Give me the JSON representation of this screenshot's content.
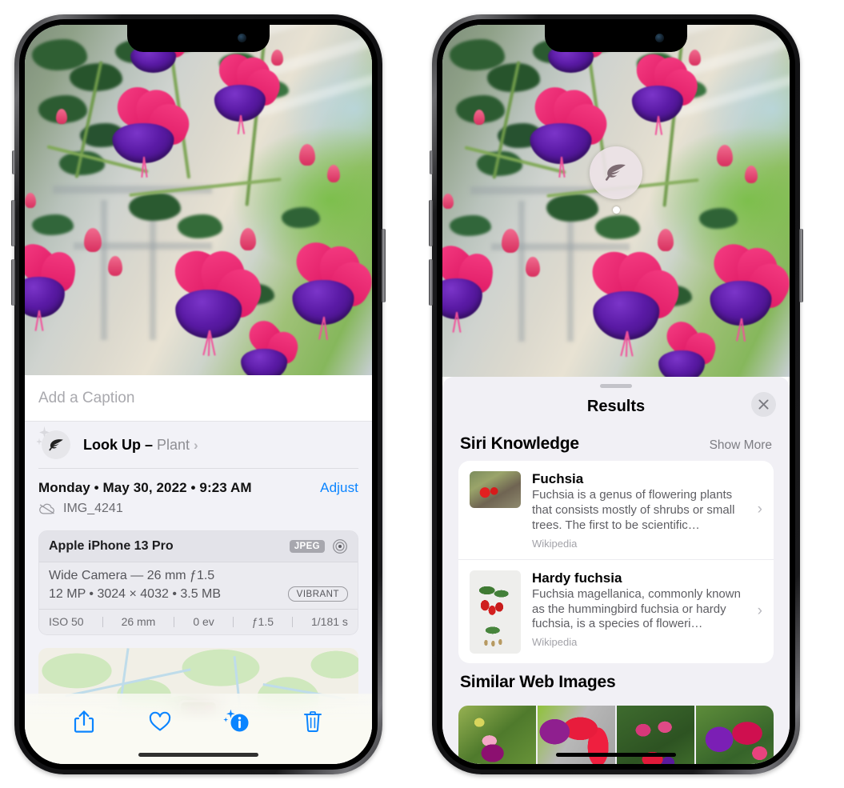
{
  "left_phone": {
    "name": "photos-detail-view",
    "caption": {
      "placeholder": "Add a Caption",
      "value": ""
    },
    "lookup": {
      "label": "Look Up – ",
      "kind": "Plant",
      "icon": "leaf-icon",
      "chevron": "›"
    },
    "date_line": "Monday • May 30, 2022 • 9:23 AM",
    "adjust_label": "Adjust",
    "filename": "IMG_4241",
    "cloud_icon": "cloud-slash-icon",
    "metadata": {
      "device": "Apple iPhone 13 Pro",
      "format_badge": "JPEG",
      "aperture_icon": "aperture-icon",
      "lens": "Wide Camera — 26 mm ƒ1.5",
      "size_line": "12 MP • 3024 × 4032 • 3.5 MB",
      "style_badge": "VIBRANT",
      "exif": [
        "ISO 50",
        "26 mm",
        "0 ev",
        "ƒ1.5",
        "1/181 s"
      ]
    },
    "toolbar": [
      {
        "name": "share-button",
        "icon": "share-icon"
      },
      {
        "name": "favorite-button",
        "icon": "heart-icon"
      },
      {
        "name": "info-button",
        "icon": "info-sparkle-icon"
      },
      {
        "name": "delete-button",
        "icon": "trash-icon"
      }
    ]
  },
  "right_phone": {
    "name": "visual-look-up-results",
    "badge": {
      "name": "visual-lookup-badge",
      "icon": "leaf-icon"
    },
    "sheet": {
      "title": "Results",
      "close_icon": "close-icon",
      "sections": [
        {
          "title": "Siri Knowledge",
          "action": "Show More",
          "items": [
            {
              "title": "Fuchsia",
              "description": "Fuchsia is a genus of flowering plants that consists mostly of shrubs or small trees. The first to be scientific…",
              "source": "Wikipedia",
              "chevron": "›"
            },
            {
              "title": "Hardy fuchsia",
              "description": "Fuchsia magellanica, commonly known as the hummingbird fuchsia or hardy fuchsia, is a species of floweri…",
              "source": "Wikipedia",
              "chevron": "›"
            }
          ]
        },
        {
          "title": "Similar Web Images",
          "action": "",
          "thumbnails": [
            "fuchsia-web-image-1",
            "fuchsia-web-image-2",
            "fuchsia-web-image-3",
            "fuchsia-web-image-4"
          ]
        }
      ]
    }
  },
  "colors": {
    "accent_blue": "#0a84ff",
    "sheet_bg": "#f2f2f7",
    "results_bg": "#f1f0f5",
    "card_bg": "#ffffff",
    "secondary_text": "#8e8e93"
  }
}
